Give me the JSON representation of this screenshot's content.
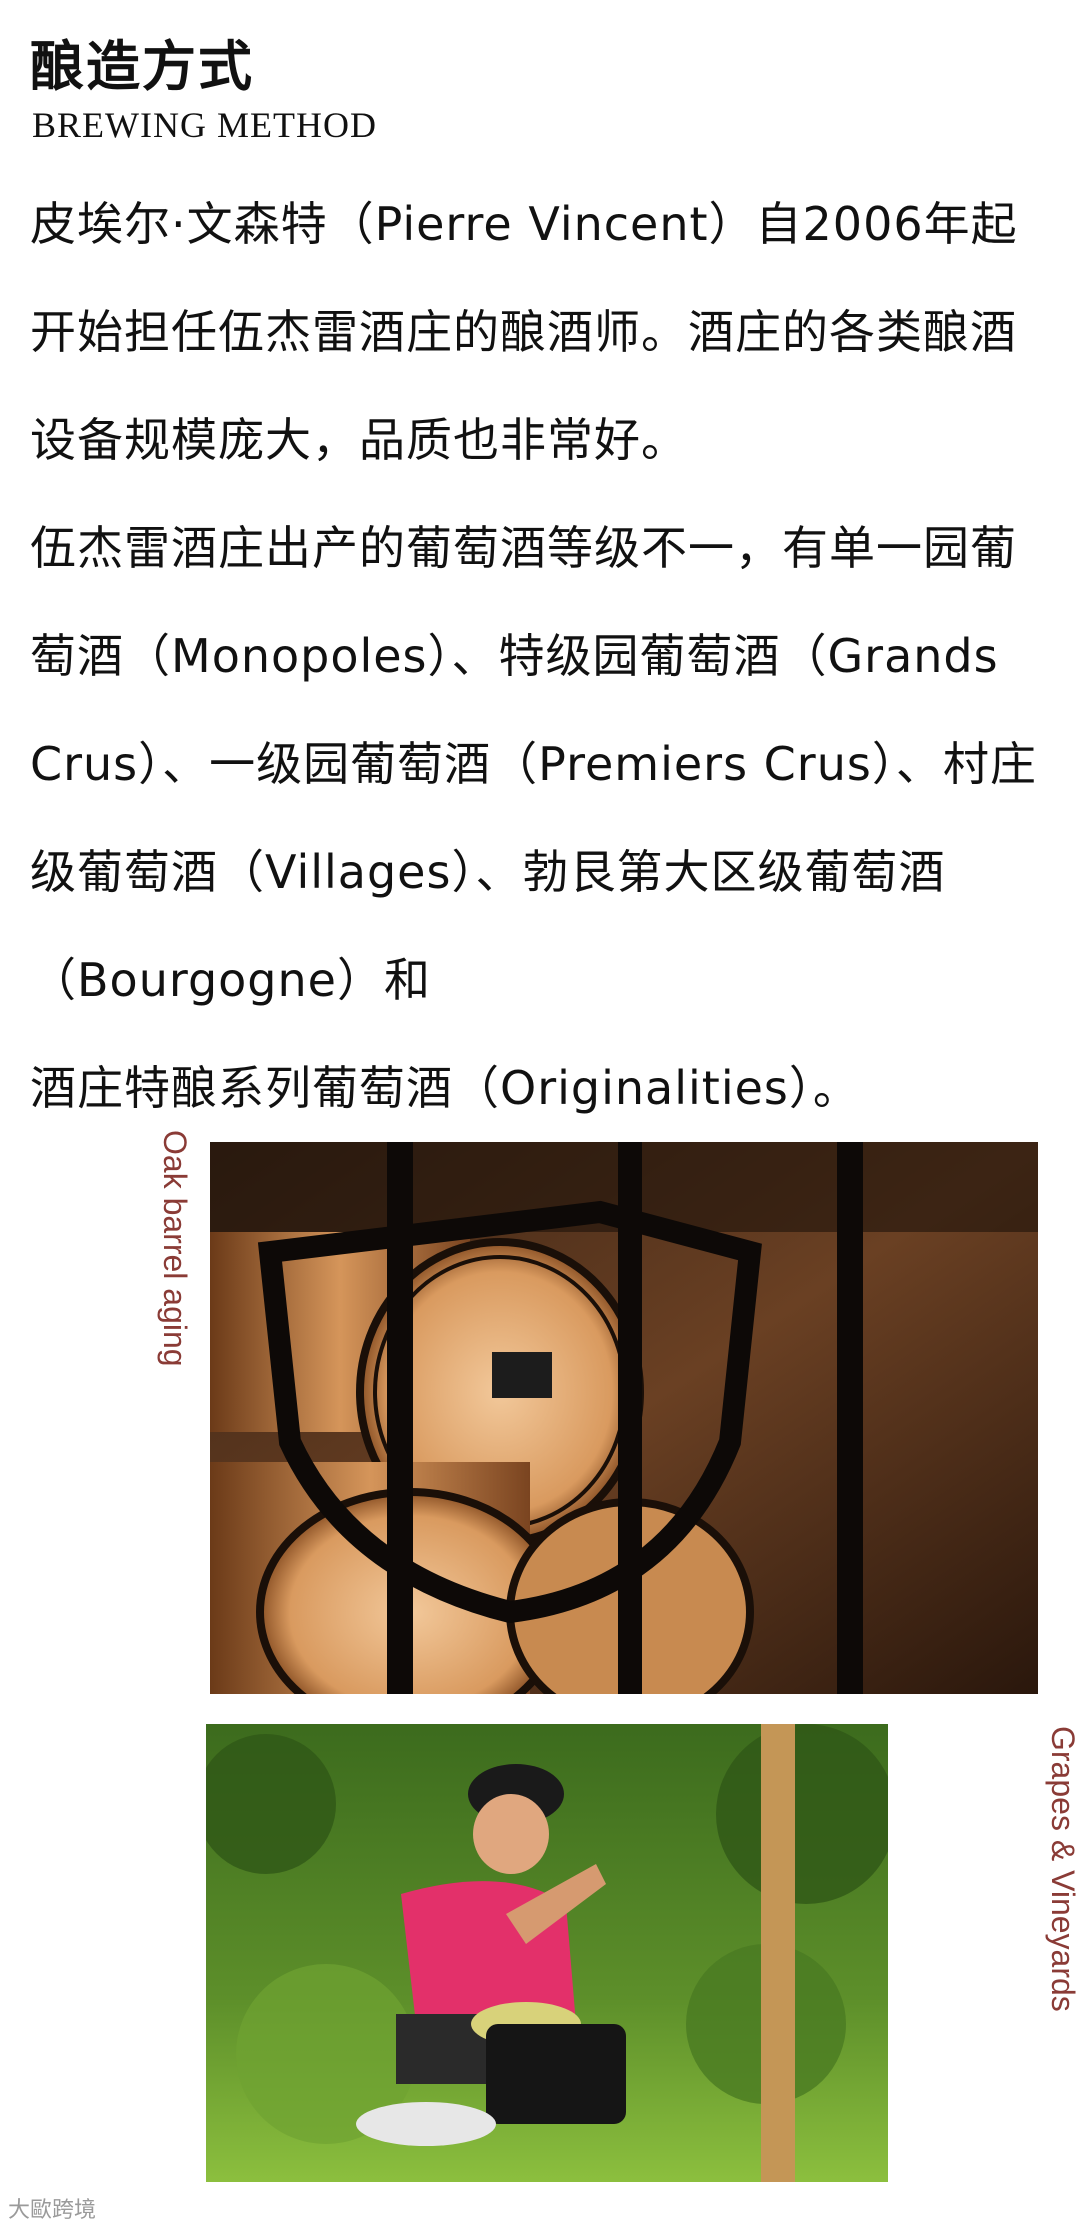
{
  "header": {
    "title": "酿造方式",
    "subtitle": "BREWING METHOD"
  },
  "paragraphs": [
    "皮埃尔·文森特（Pierre Vincent）自2006年起开始担任伍杰雷酒庄的酿酒师。酒庄的各类酿酒设备规模庞大，品质也非常好。",
    "伍杰雷酒庄出产的葡萄酒等级不一，有单一园葡萄酒（Monopoles）、特级园葡萄酒（Grands Crus）、一级园葡萄酒（Premiers Crus）、村庄级葡萄酒（Villages）、勃艮第大区级葡萄酒（Bourgogne）和",
    "酒庄特酿系列葡萄酒（Originalities）。"
  ],
  "images": {
    "barrel_caption": "Oak barrel aging",
    "vineyard_caption": "Grapes & Vineyards"
  },
  "watermark": "大歐跨境",
  "colors": {
    "caption": "#8a3b36"
  }
}
